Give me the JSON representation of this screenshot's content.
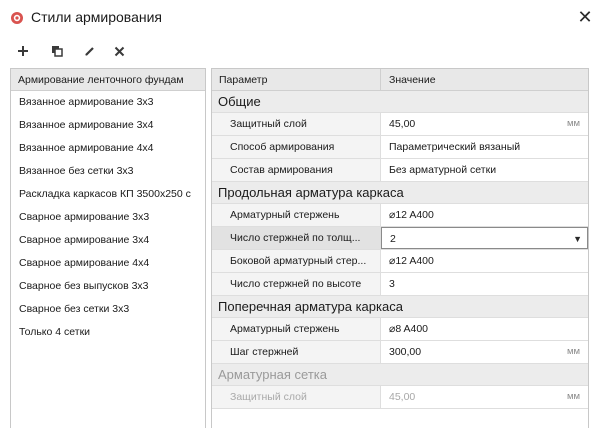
{
  "window": {
    "title": "Стили армирования"
  },
  "toolbar": {
    "add_icon": "plus-icon",
    "copy_icon": "copy-icon",
    "edit_icon": "pencil-icon",
    "delete_icon": "x-icon"
  },
  "left_panel": {
    "header": "Армирование ленточного фундам",
    "items": [
      "Вязанное армирование 3х3",
      "Вязанное армирование 3х4",
      "Вязанное армирование 4х4",
      "Вязанное без сетки 3х3",
      "Раскладка каркасов КП 3500х250 с",
      "Сварное армирование 3х3",
      "Сварное армирование 3х4",
      "Сварное армирование 4х4",
      "Сварное без выпусков 3х3",
      "Сварное без сетки 3х3",
      "Только 4 сетки"
    ]
  },
  "grid": {
    "col_param": "Параметр",
    "col_value": "Значение",
    "sections": [
      {
        "title": "Общие",
        "rows": [
          {
            "param": "Защитный слой",
            "value": "45,00",
            "unit": "мм"
          },
          {
            "param": "Способ армирования",
            "value": "Параметрический вязаный",
            "unit": ""
          },
          {
            "param": "Состав армирования",
            "value": "Без арматурной сетки",
            "unit": ""
          }
        ]
      },
      {
        "title": "Продольная арматура каркаса",
        "rows": [
          {
            "param": "Арматурный стержень",
            "value": "⌀12 A400",
            "unit": ""
          },
          {
            "param": "Число стержней по толщ...",
            "value": "2",
            "unit": ""
          },
          {
            "param": "Боковой арматурный стер...",
            "value": "⌀12 A400",
            "unit": ""
          },
          {
            "param": "Число стержней по высоте",
            "value": "3",
            "unit": ""
          }
        ]
      },
      {
        "title": "Поперечная арматура каркаса",
        "rows": [
          {
            "param": "Арматурный стержень",
            "value": "⌀8 A400",
            "unit": ""
          },
          {
            "param": "Шаг стержней",
            "value": "300,00",
            "unit": "мм"
          }
        ]
      },
      {
        "title": "Арматурная сетка",
        "rows": [
          {
            "param": "Защитный слой",
            "value": "45,00",
            "unit": "мм"
          }
        ]
      }
    ]
  },
  "colors": {
    "app_icon": "#d9534f",
    "header_bg": "#e8e8e8",
    "section_bg": "#ececec"
  }
}
